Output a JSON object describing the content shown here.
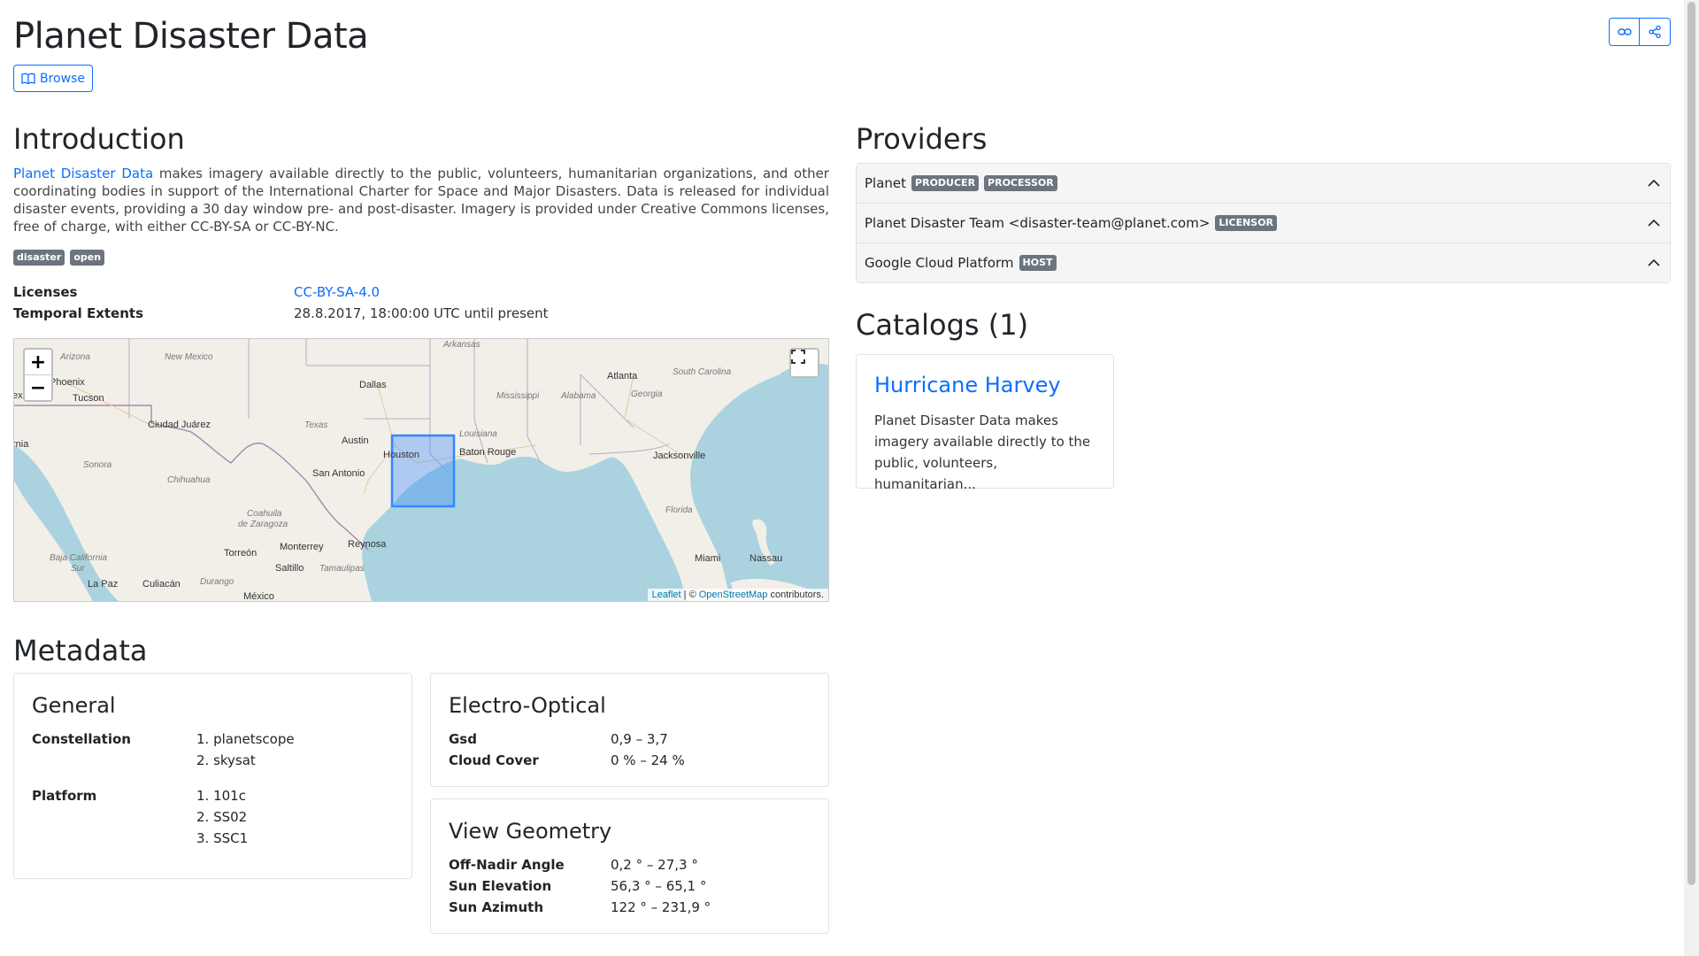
{
  "header": {
    "title": "Planet Disaster Data",
    "browse_label": "Browse",
    "link_icon": "link-icon",
    "share_icon": "share-icon"
  },
  "intro": {
    "heading": "Introduction",
    "link_text": "Planet Disaster Data",
    "text": " makes imagery available directly to the public, volunteers, humanitarian organizations, and other coordinating bodies in support of the International Charter for Space and Major Disasters. Data is released for individual disaster events, providing a 30 day window pre- and post-disaster. Imagery is provided under Creative Commons licenses, free of charge, with either CC-BY-SA or CC-BY-NC.",
    "keywords": [
      "disaster",
      "open"
    ],
    "licenses_label": "Licenses",
    "licenses_value": "CC-BY-SA-4.0",
    "temporal_label": "Temporal Extents",
    "temporal_value": "28.8.2017, 18:00:00 UTC until present"
  },
  "map": {
    "zoom_in": "+",
    "zoom_out": "−",
    "attribution_leaflet": "Leaflet",
    "attribution_sep": " | © ",
    "attribution_osm": "OpenStreetMap",
    "attribution_tail": " contributors.",
    "labels": {
      "arizona": "Arizona",
      "new_mexico": "New Mexico",
      "arkansas": "Arkansas",
      "phoenix": "Phoenix",
      "tucson": "Tucson",
      "dallas": "Dallas",
      "atlanta": "Atlanta",
      "south_carolina": "South Carolina",
      "mississippi": "Mississippi",
      "alabama": "Alabama",
      "georgia": "Georgia",
      "ciudad_juarez": "Ciudad Juárez",
      "texas": "Texas",
      "louisiana": "Louisiana",
      "austin": "Austin",
      "houston": "Houston",
      "baton_rouge": "Baton Rouge",
      "jacksonville": "Jacksonville",
      "sonora": "Sonora",
      "chihuahua": "Chihuahua",
      "san_antonio": "San Antonio",
      "coahuila": "Coahuila",
      "de_zaragoza": "de Zaragoza",
      "florida": "Florida",
      "reynosa": "Reynosa",
      "torreon": "Torreón",
      "monterrey": "Monterrey",
      "miami": "Miami",
      "nassau": "Nassau",
      "saltillo": "Saltillo",
      "tamaulipas": "Tamaulipas",
      "baja_california": "Baja California",
      "sur": "Sur",
      "la_paz": "La Paz",
      "culiacan": "Culiacán",
      "durango": "Durango",
      "mexico": "México",
      "exi": "exi",
      "rnia": "rnia"
    }
  },
  "metadata": {
    "heading": "Metadata",
    "general": {
      "title": "General",
      "constellation_label": "Constellation",
      "constellation": [
        "1. planetscope",
        "2. skysat"
      ],
      "platform_label": "Platform",
      "platform": [
        "1. 101c",
        "2. SS02",
        "3. SSC1"
      ]
    },
    "eo": {
      "title": "Electro-Optical",
      "gsd_label": "Gsd",
      "gsd_value": "0,9 – 3,7",
      "cloud_label": "Cloud Cover",
      "cloud_value": "0 % – 24 %"
    },
    "view": {
      "title": "View Geometry",
      "offnadir_label": "Off-Nadir Angle",
      "offnadir_value": "0,2 ° – 27,3 °",
      "sunelev_label": "Sun Elevation",
      "sunelev_value": "56,3 ° – 65,1 °",
      "sunaz_label": "Sun Azimuth",
      "sunaz_value": "122 ° – 231,9 °"
    }
  },
  "providers": {
    "heading": "Providers",
    "items": [
      {
        "name": "Planet",
        "roles": [
          "PRODUCER",
          "PROCESSOR"
        ]
      },
      {
        "name": "Planet Disaster Team <disaster-team@planet.com>",
        "roles": [
          "LICENSOR"
        ]
      },
      {
        "name": "Google Cloud Platform",
        "roles": [
          "HOST"
        ]
      }
    ]
  },
  "catalogs": {
    "heading": "Catalogs (1)",
    "items": [
      {
        "title": "Hurricane Harvey",
        "description": "Planet Disaster Data makes imagery available directly to the public, volunteers, humanitarian..."
      }
    ]
  },
  "colors": {
    "accent": "#0d6efd",
    "badge": "#6c757d",
    "water": "#aad3df",
    "land": "#f2efe9",
    "bbox": "#3388ff"
  }
}
